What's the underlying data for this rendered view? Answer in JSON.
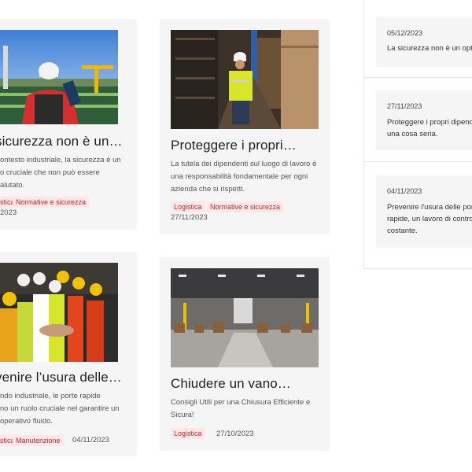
{
  "posts": [
    {
      "title": "sicurezza non è un…",
      "excerpt_lines": [
        "ontesto industriale, la sicurezza è un",
        "o cruciale che non può essere",
        "alutato."
      ],
      "tags": [
        "stica",
        "Normative e sicurezza"
      ],
      "date": "2023"
    },
    {
      "title": "Proteggere i propri…",
      "excerpt_lines": [
        "La tutela dei dipendenti sul luogo di lavoro è",
        "una responsabilità fondamentale per ogni",
        "azienda che si rispetti."
      ],
      "tags": [
        "Logistica",
        "Normative e sicurezza"
      ],
      "date": "27/11/2023"
    },
    {
      "title": "venire l’usura delle…",
      "excerpt_lines": [
        "ndo industriale, le porte rapide",
        "no un ruolo cruciale nel garantire un",
        "operativo fluido."
      ],
      "tags": [
        "stica",
        "Manutenzione"
      ],
      "date": "04/11/2023"
    },
    {
      "title": "Chiudere un vano…",
      "excerpt_lines": [
        "Consigli Utili per una Chiusura Efficiente e",
        "Sicura!"
      ],
      "tags": [
        "Logistica"
      ],
      "date": "27/10/2023"
    }
  ],
  "sidebar": {
    "items": [
      {
        "date": "05/12/2023",
        "lines": [
          "La sicurezza non è un optio"
        ]
      },
      {
        "date": "27/11/2023",
        "lines": [
          "Proteggere i propri dipende",
          "una cosa seria."
        ]
      },
      {
        "date": "04/11/2023",
        "lines": [
          "Prevenire l'usura delle porte",
          "rapide, un lavoro di controll",
          "costante."
        ]
      }
    ]
  },
  "colors": {
    "tag_text": "#c62828",
    "tag_bg": "#ffe7e7",
    "card_bg": "#f5f5f5"
  }
}
